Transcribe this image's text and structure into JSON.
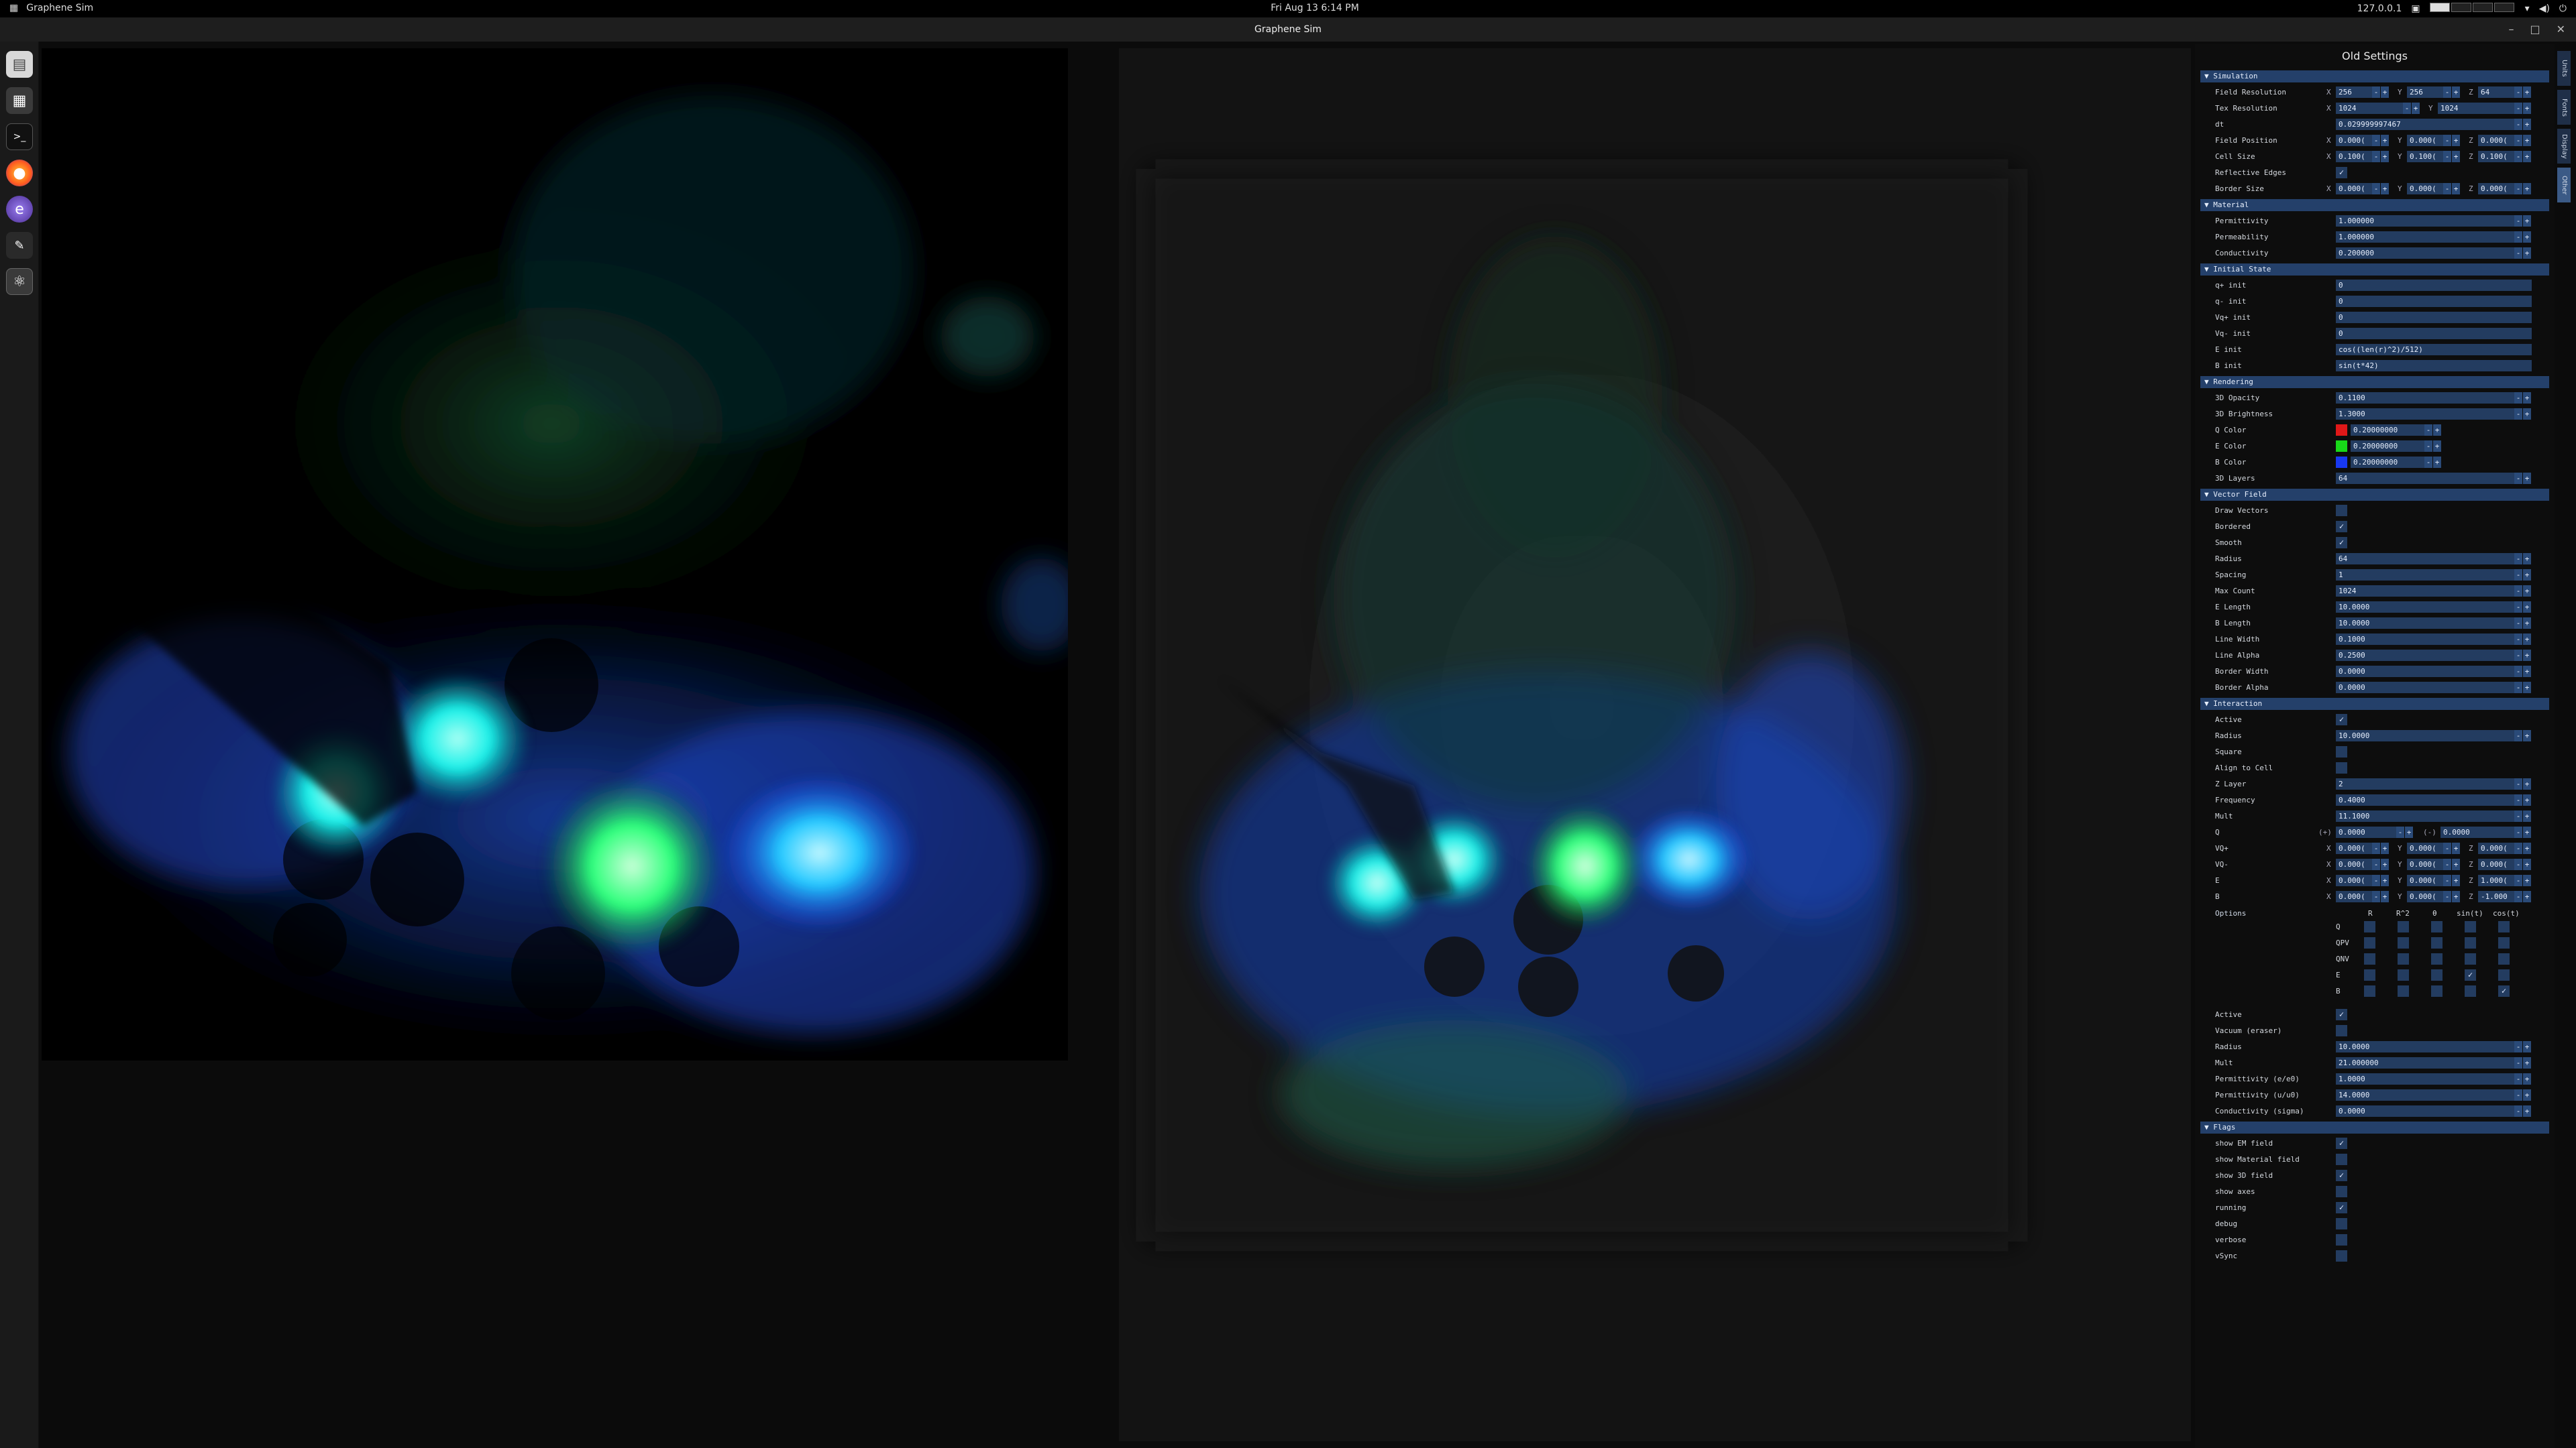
{
  "topbar": {
    "app": "Graphene Sim",
    "clock": "Fri Aug 13   6:14 PM",
    "ip": "127.0.0.1"
  },
  "window": {
    "title": "Graphene Sim"
  },
  "panel": {
    "title": "Old Settings",
    "tabs": [
      "Units",
      "Fonts",
      "Display",
      "Other"
    ],
    "sections": {
      "simulation": "▼ Simulation",
      "material": "▼ Material",
      "initial": "▼ Initial State",
      "rendering": "▼ Rendering",
      "vector": "▼ Vector Field",
      "interaction": "▼ Interaction",
      "flags": "▼ Flags"
    },
    "simulation": {
      "field_res": {
        "label": "Field Resolution",
        "x": "256",
        "y": "256",
        "z": "64"
      },
      "tex_res": {
        "label": "Tex Resolution",
        "x": "1024",
        "y": "1024"
      },
      "dt": {
        "label": "dt",
        "value": "0.029999997467"
      },
      "field_pos": {
        "label": "Field Position",
        "x": "0.000(",
        "y": "0.000(",
        "z": "0.000("
      },
      "cell_size": {
        "label": "Cell Size",
        "x": "0.100(",
        "y": "0.100(",
        "z": "0.100("
      },
      "reflective": {
        "label": "Reflective Edges"
      },
      "border": {
        "label": "Border Size",
        "x": "0.000(",
        "y": "0.000(",
        "z": "0.000("
      }
    },
    "material": {
      "permittivity": {
        "label": "Permittivity",
        "value": "1.000000"
      },
      "permeability": {
        "label": "Permeability",
        "value": "1.000000"
      },
      "conductivity": {
        "label": "Conductivity",
        "value": "0.200000"
      }
    },
    "initial": {
      "qp": {
        "label": "q+ init",
        "value": "0"
      },
      "qn": {
        "label": "q- init",
        "value": "0"
      },
      "vqp": {
        "label": "Vq+ init",
        "value": "0"
      },
      "vqn": {
        "label": "Vq- init",
        "value": "0"
      },
      "e": {
        "label": "E init",
        "value": "cos((len(r)^2)/512)"
      },
      "b": {
        "label": "B init",
        "value": "sin(t*42)"
      }
    },
    "rendering": {
      "opacity": {
        "label": "3D Opacity",
        "value": "0.1100"
      },
      "brightness": {
        "label": "3D Brightness",
        "value": "1.3000"
      },
      "qcolor": {
        "label": "Q Color",
        "value": "0.20000000",
        "swatch": "#e01818"
      },
      "ecolor": {
        "label": "E Color",
        "value": "0.20000000",
        "swatch": "#18d818"
      },
      "bcolor": {
        "label": "B Color",
        "value": "0.20000000",
        "swatch": "#1838f0"
      },
      "layers": {
        "label": "3D Layers",
        "value": "64"
      }
    },
    "vector": {
      "draw": {
        "label": "Draw Vectors"
      },
      "bordered": {
        "label": "Bordered"
      },
      "smooth": {
        "label": "Smooth"
      },
      "radius": {
        "label": "Radius",
        "value": "64"
      },
      "spacing": {
        "label": "Spacing",
        "value": "1"
      },
      "maxcount": {
        "label": "Max Count",
        "value": "1024"
      },
      "elen": {
        "label": "E Length",
        "value": "10.0000"
      },
      "blen": {
        "label": "B Length",
        "value": "10.0000"
      },
      "lw": {
        "label": "Line Width",
        "value": "0.1000"
      },
      "la": {
        "label": "Line Alpha",
        "value": "0.2500"
      },
      "bw": {
        "label": "Border Width",
        "value": "0.0000"
      },
      "ba": {
        "label": "Border Alpha",
        "value": "0.0000"
      }
    },
    "interaction": {
      "active": {
        "label": "Active"
      },
      "radius": {
        "label": "Radius",
        "value": "10.0000"
      },
      "square": {
        "label": "Square"
      },
      "align": {
        "label": "Align to Cell"
      },
      "zlayer": {
        "label": "Z Layer",
        "value": "2"
      },
      "freq": {
        "label": "Frequency",
        "value": "0.4000"
      },
      "mult": {
        "label": "Mult",
        "value": "11.1000"
      },
      "q": {
        "label": "Q",
        "plus": "(+)",
        "pv": "0.0000",
        "minus": "(-)",
        "mv": "0.0000"
      },
      "vqp": {
        "label": "VQ+",
        "x": "0.000(",
        "y": "0.000(",
        "z": "0.000("
      },
      "vqn": {
        "label": "VQ-",
        "x": "0.000(",
        "y": "0.000(",
        "z": "0.000("
      },
      "e": {
        "label": "E",
        "x": "0.000(",
        "y": "0.000(",
        "z": "1.000("
      },
      "b": {
        "label": "B",
        "x": "0.000(",
        "y": "0.000(",
        "z": "-1.000"
      },
      "options": {
        "label": "Options",
        "cols": [
          "R",
          "R^2",
          "θ",
          "sin(t)",
          "cos(t)"
        ],
        "rows": [
          {
            "name": "Q",
            "checks": [
              false,
              false,
              false,
              false,
              false
            ]
          },
          {
            "name": "QPV",
            "checks": [
              false,
              false,
              false,
              false,
              false
            ]
          },
          {
            "name": "QNV",
            "checks": [
              false,
              false,
              false,
              false,
              false
            ]
          },
          {
            "name": "E",
            "checks": [
              false,
              false,
              false,
              true,
              false
            ]
          },
          {
            "name": "B",
            "checks": [
              false,
              false,
              false,
              false,
              true
            ]
          }
        ]
      },
      "mat_active": {
        "label": "Active"
      },
      "vacuum": {
        "label": "Vacuum (eraser)"
      },
      "mat_radius": {
        "label": "Radius",
        "value": "10.0000"
      },
      "mat_mult": {
        "label": "Mult",
        "value": "21.000000"
      },
      "perm_e": {
        "label": "Permittivity (e/e0)",
        "value": "1.0000"
      },
      "perm_u": {
        "label": "Permittivity (u/u0)",
        "value": "14.0000"
      },
      "cond": {
        "label": "Conductivity (sigma)",
        "value": "0.0000"
      }
    },
    "flags": {
      "emfield": {
        "label": "show EM field"
      },
      "matfield": {
        "label": "show Material field"
      },
      "field3d": {
        "label": "show 3D field"
      },
      "axes": {
        "label": "show axes"
      },
      "running": {
        "label": "running"
      },
      "debug": {
        "label": "debug"
      },
      "verbose": {
        "label": "verbose"
      },
      "vsync": {
        "label": "vSync"
      }
    }
  },
  "colors": {
    "accent": "#24406a",
    "field": "#233c60",
    "glow_cyan": "#17f0e8",
    "glow_green": "#2cff7a",
    "glow_blue": "#3a6cff"
  }
}
